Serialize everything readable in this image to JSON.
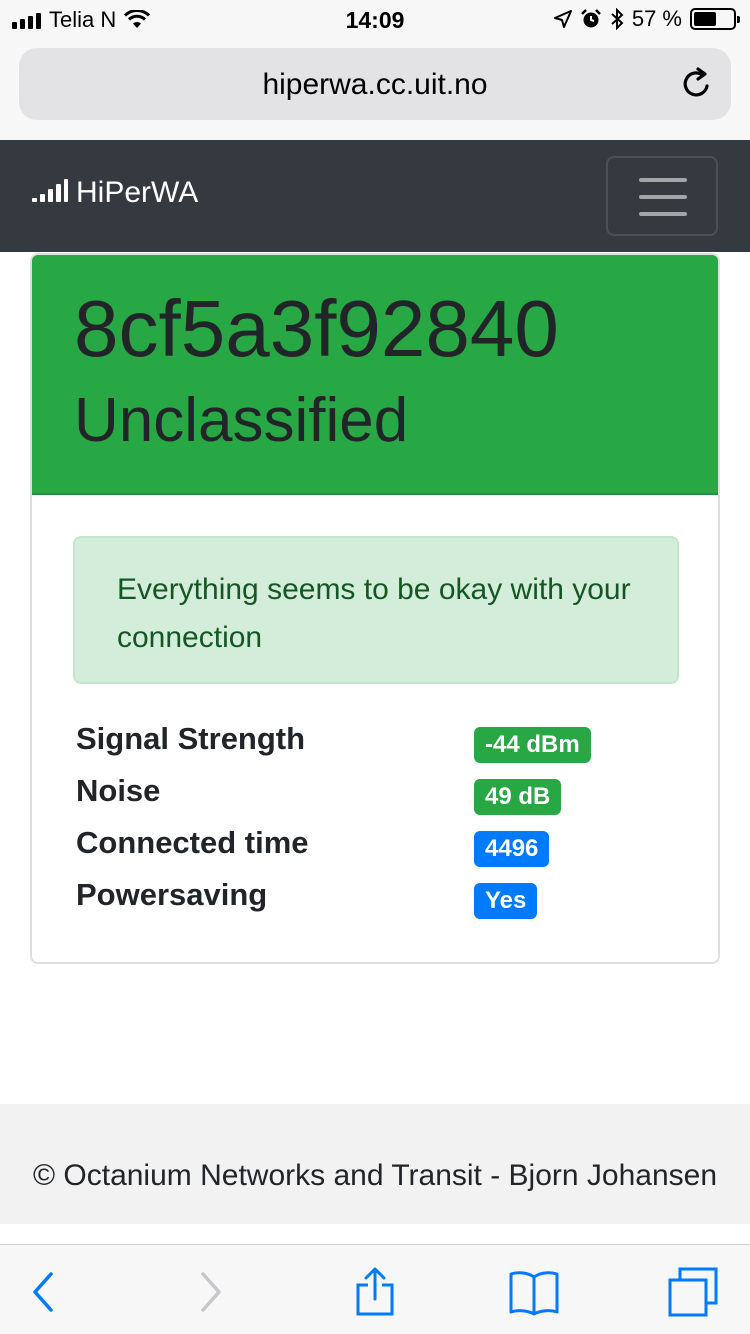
{
  "status_bar": {
    "carrier": "Telia N",
    "time": "14:09",
    "battery": "57 %",
    "battery_level": 0.57,
    "icons": [
      "signal-icon",
      "wifi-icon",
      "location-arrow-icon",
      "alarm-icon",
      "bluetooth-icon",
      "battery-icon"
    ]
  },
  "browser": {
    "url": "hiperwa.cc.uit.no",
    "reload_icon": "reload-icon"
  },
  "navbar": {
    "brand": "HiPerWA",
    "brand_icon": "signal-icon",
    "toggler_icon": "hamburger-menu-icon"
  },
  "card": {
    "device_id": "8cf5a3f92840",
    "classification": "Unclassified",
    "header_color": "#28a745",
    "alert": "Everything seems to be okay with your connection",
    "stats": [
      {
        "label": "Signal Strength",
        "value": "-44 dBm",
        "badge": "success"
      },
      {
        "label": "Noise",
        "value": "49 dB",
        "badge": "success"
      },
      {
        "label": "Connected time",
        "value": "4496",
        "badge": "primary"
      },
      {
        "label": "Powersaving",
        "value": "Yes",
        "badge": "primary"
      }
    ]
  },
  "footer": {
    "text": "© Octanium Networks and Transit - Bjorn Johansen"
  },
  "toolbar": {
    "icons": [
      "back-icon",
      "forward-icon",
      "share-icon",
      "bookmarks-icon",
      "tabs-icon"
    ],
    "accent": "#007aff"
  }
}
